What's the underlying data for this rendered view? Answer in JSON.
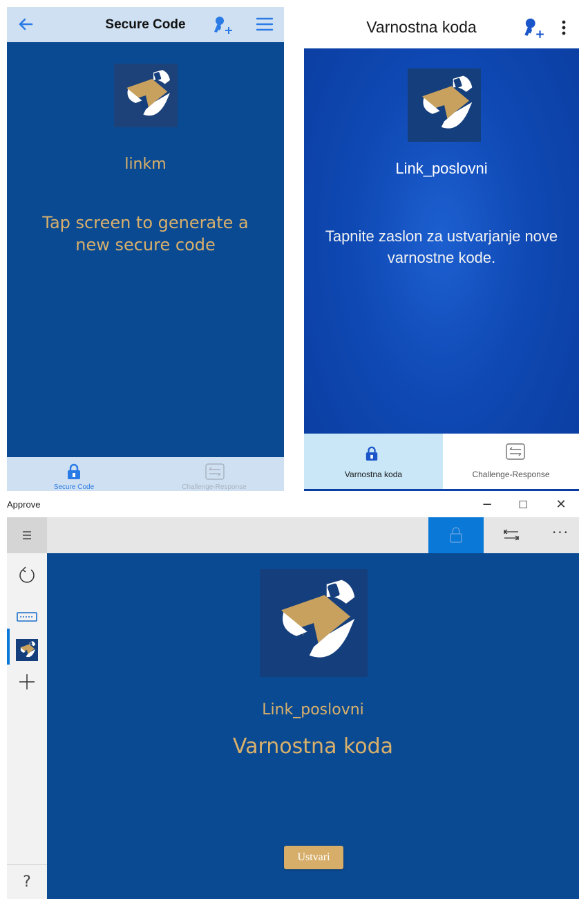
{
  "ios": {
    "title": "Secure Code",
    "account_name": "linkm",
    "instruction": "Tap screen to generate a new secure code",
    "tabs": [
      {
        "label": "Secure Code",
        "icon": "lock-icon",
        "active": true
      },
      {
        "label": "Challenge-Response",
        "icon": "challenge-response-icon",
        "active": false
      }
    ],
    "icons": [
      "back-arrow-icon",
      "add-key-icon",
      "hamburger-menu-icon"
    ],
    "colors": {
      "bar": "#cfe0f2",
      "accent": "#2b7be6",
      "background": "#0a4a92",
      "text": "#d9b06b"
    }
  },
  "android": {
    "title": "Varnostna koda",
    "account_name": "Link_poslovni",
    "instruction": "Tapnite zaslon za ustvarjanje nove varnostne kode.",
    "tabs": [
      {
        "label": "Varnostna koda",
        "icon": "lock-icon",
        "active": true
      },
      {
        "label": "Challenge-Response",
        "icon": "challenge-response-icon",
        "active": false
      }
    ],
    "icons": [
      "add-key-icon",
      "more-vertical-icon"
    ],
    "colors": {
      "background": "#0f49b4",
      "active_tab": "#c9e7f7"
    }
  },
  "windows": {
    "app_title": "Approve",
    "window_controls": {
      "minimize": "−",
      "maximize": "☐",
      "close": "✕"
    },
    "more_label": "···",
    "help_label": "?",
    "nav_icons": [
      "refresh-icon",
      "keyboard-icon",
      "account-logo-icon",
      "add-icon"
    ],
    "account_name": "Link_poslovni",
    "heading": "Varnostna koda",
    "button_label": "Ustvari",
    "colors": {
      "accent": "#0a78d7",
      "background": "#0a4a92",
      "text": "#d9b06b",
      "button": "#d6ae6a"
    }
  }
}
